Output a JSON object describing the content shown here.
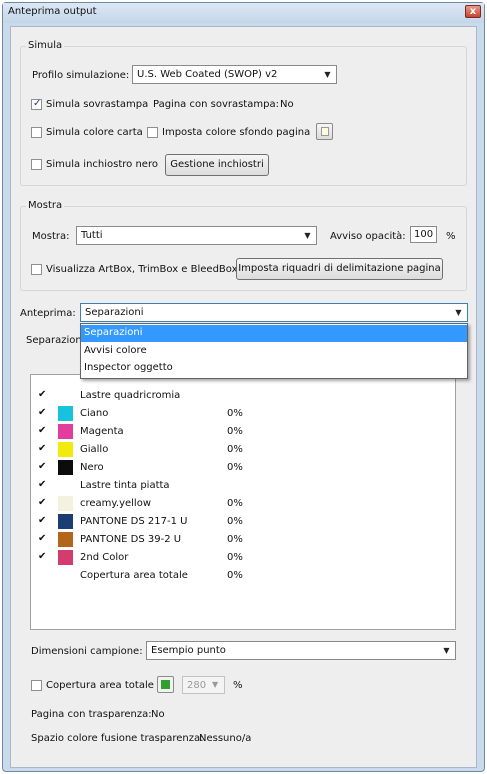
{
  "window": {
    "title": "Anteprima output",
    "close_glyph": "x"
  },
  "simula": {
    "label": "Simula",
    "profile_label": "Profilo simulazione:",
    "profile_value": "U.S. Web Coated (SWOP) v2",
    "simula_sovrastampa": "Simula sovrastampa",
    "pagina_sovrastampa_label": "Pagina con sovrastampa:",
    "pagina_sovrastampa_value": "No",
    "simula_colore_carta": "Simula colore carta",
    "imposta_colore_sfondo": "Imposta colore sfondo pagina",
    "simula_inchiostro_nero": "Simula inchiostro nero",
    "gestione_inchiostri": "Gestione inchiostri",
    "checks": {
      "sovrastampa": true,
      "colore_carta": false,
      "sfondo": false,
      "inchiostro_nero": false
    }
  },
  "mostra": {
    "label": "Mostra",
    "mostra_label": "Mostra:",
    "mostra_value": "Tutti",
    "avviso_label": "Avviso opacità:",
    "avviso_value": "100",
    "avviso_unit": "%",
    "visualizza_boxes": "Visualizza ArtBox, TrimBox e BleedBox",
    "imposta_riquadri": "Imposta riquadri di delimitazione pagina"
  },
  "anteprima": {
    "label": "Anteprima:",
    "value": "Separazioni",
    "options": [
      "Separazioni",
      "Avvisi colore",
      "Inspector oggetto"
    ],
    "selected_index": 0
  },
  "separazioni": {
    "label": "Separazioni",
    "rows": [
      {
        "checked": true,
        "swatch": "",
        "name": "Lastre quadricromia",
        "pct": ""
      },
      {
        "checked": true,
        "swatch": "#16c2de",
        "name": "Ciano",
        "pct": "0%"
      },
      {
        "checked": true,
        "swatch": "#e23c9c",
        "name": "Magenta",
        "pct": "0%"
      },
      {
        "checked": true,
        "swatch": "#f2ea0c",
        "name": "Giallo",
        "pct": "0%"
      },
      {
        "checked": true,
        "swatch": "#0c0c0c",
        "name": "Nero",
        "pct": "0%"
      },
      {
        "checked": true,
        "swatch": "",
        "name": "Lastre tinta piatta",
        "pct": ""
      },
      {
        "checked": true,
        "swatch": "#f3f2df",
        "name": "creamy.yellow",
        "pct": "0%"
      },
      {
        "checked": true,
        "swatch": "#1c3d72",
        "name": "PANTONE DS 217-1 U",
        "pct": "0%"
      },
      {
        "checked": true,
        "swatch": "#b3651c",
        "name": "PANTONE DS 39-2 U",
        "pct": "0%"
      },
      {
        "checked": true,
        "swatch": "#d43c70",
        "name": "2nd Color",
        "pct": "0%"
      },
      {
        "checked": false,
        "swatch": "",
        "name": "Copertura area totale",
        "pct": "0%"
      }
    ]
  },
  "bottom": {
    "dimensioni_label": "Dimensioni campione:",
    "dimensioni_value": "Esempio punto",
    "copertura_label": "Copertura area totale",
    "copertura_value": "280",
    "copertura_unit": "%",
    "copertura_color": "#2ea02e",
    "trasparenza_label": "Pagina con trasparenza:",
    "trasparenza_value": "No",
    "spazio_label": "Spazio colore fusione trasparenza:",
    "spazio_value": "Nessuno/a"
  }
}
